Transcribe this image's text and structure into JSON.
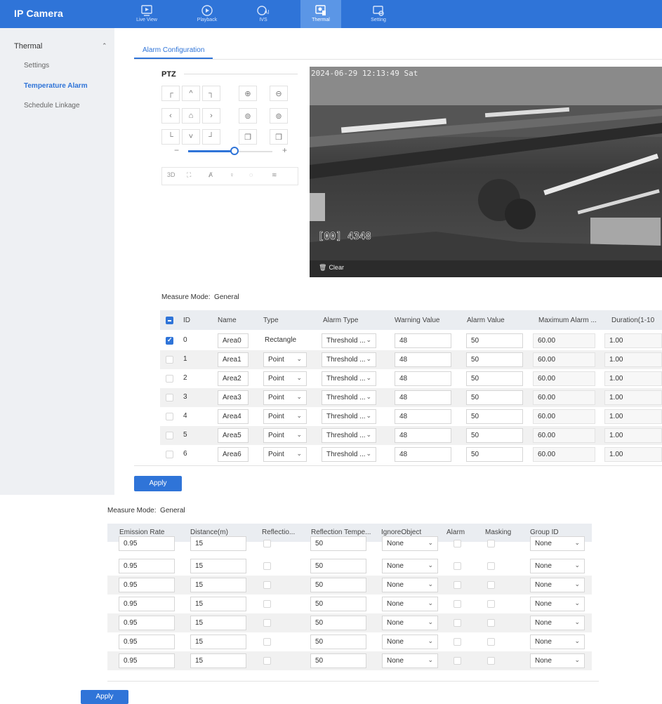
{
  "app": {
    "title": "IP Camera"
  },
  "nav": [
    {
      "label": "Live View",
      "icon": "live-view-icon"
    },
    {
      "label": "Playback",
      "icon": "playback-icon"
    },
    {
      "label": "IVS",
      "icon": "ivs-icon"
    },
    {
      "label": "Thermal",
      "icon": "thermal-icon",
      "active": true
    },
    {
      "label": "Setting",
      "icon": "setting-icon"
    }
  ],
  "sidebar": {
    "section": "Thermal",
    "items": [
      {
        "label": "Settings"
      },
      {
        "label": "Temperature Alarm",
        "active": true
      },
      {
        "label": "Schedule Linkage"
      }
    ]
  },
  "tabs": [
    {
      "label": "Alarm Configuration",
      "active": true
    }
  ],
  "ptz": {
    "title": "PTZ",
    "speed_level": 0.55
  },
  "video": {
    "osd_time": "2024-06-29 12:13:49 Sat",
    "clear_label": "Clear",
    "overlay_text": "[00] 4348"
  },
  "measure_mode": {
    "label": "Measure Mode:",
    "value": "General"
  },
  "table1": {
    "columns": [
      "ID",
      "Name",
      "Type",
      "Alarm Type",
      "Warning Value",
      "Alarm Value",
      "Maximum Alarm ...",
      "Duration(1-10"
    ],
    "rows": [
      {
        "checked": true,
        "id": "0",
        "name": "Area0",
        "type": "Rectangle",
        "type_select": false,
        "alarm_type": "Threshold ...",
        "warning": "48",
        "alarm": "50",
        "max_alarm": "60.00",
        "duration": "1.00"
      },
      {
        "checked": false,
        "id": "1",
        "name": "Area1",
        "type": "Point",
        "type_select": true,
        "alarm_type": "Threshold ...",
        "warning": "48",
        "alarm": "50",
        "max_alarm": "60.00",
        "duration": "1.00"
      },
      {
        "checked": false,
        "id": "2",
        "name": "Area2",
        "type": "Point",
        "type_select": true,
        "alarm_type": "Threshold ...",
        "warning": "48",
        "alarm": "50",
        "max_alarm": "60.00",
        "duration": "1.00"
      },
      {
        "checked": false,
        "id": "3",
        "name": "Area3",
        "type": "Point",
        "type_select": true,
        "alarm_type": "Threshold ...",
        "warning": "48",
        "alarm": "50",
        "max_alarm": "60.00",
        "duration": "1.00"
      },
      {
        "checked": false,
        "id": "4",
        "name": "Area4",
        "type": "Point",
        "type_select": true,
        "alarm_type": "Threshold ...",
        "warning": "48",
        "alarm": "50",
        "max_alarm": "60.00",
        "duration": "1.00"
      },
      {
        "checked": false,
        "id": "5",
        "name": "Area5",
        "type": "Point",
        "type_select": true,
        "alarm_type": "Threshold ...",
        "warning": "48",
        "alarm": "50",
        "max_alarm": "60.00",
        "duration": "1.00"
      },
      {
        "checked": false,
        "id": "6",
        "name": "Area6",
        "type": "Point",
        "type_select": true,
        "alarm_type": "Threshold ...",
        "warning": "48",
        "alarm": "50",
        "max_alarm": "60.00",
        "duration": "1.00"
      }
    ]
  },
  "apply_label": "Apply",
  "table2": {
    "columns": [
      "Emission Rate",
      "Distance(m)",
      "Reflectio...",
      "Reflection Tempe...",
      "IgnoreObject",
      "Alarm",
      "Masking",
      "Group ID"
    ],
    "rows": [
      {
        "emission": "0.95",
        "distance": "15",
        "refl_temp": "50",
        "ignore": "None",
        "group": "None"
      },
      {
        "emission": "0.95",
        "distance": "15",
        "refl_temp": "50",
        "ignore": "None",
        "group": "None"
      },
      {
        "emission": "0.95",
        "distance": "15",
        "refl_temp": "50",
        "ignore": "None",
        "group": "None"
      },
      {
        "emission": "0.95",
        "distance": "15",
        "refl_temp": "50",
        "ignore": "None",
        "group": "None"
      },
      {
        "emission": "0.95",
        "distance": "15",
        "refl_temp": "50",
        "ignore": "None",
        "group": "None"
      },
      {
        "emission": "0.95",
        "distance": "15",
        "refl_temp": "50",
        "ignore": "None",
        "group": "None"
      },
      {
        "emission": "0.95",
        "distance": "15",
        "refl_temp": "50",
        "ignore": "None",
        "group": "None"
      }
    ]
  },
  "colors": {
    "brand": "#2f74d8",
    "nav_active": "#5b96e6",
    "sidebar_bg": "#eef0f3",
    "header_bg": "#eaedf1"
  }
}
